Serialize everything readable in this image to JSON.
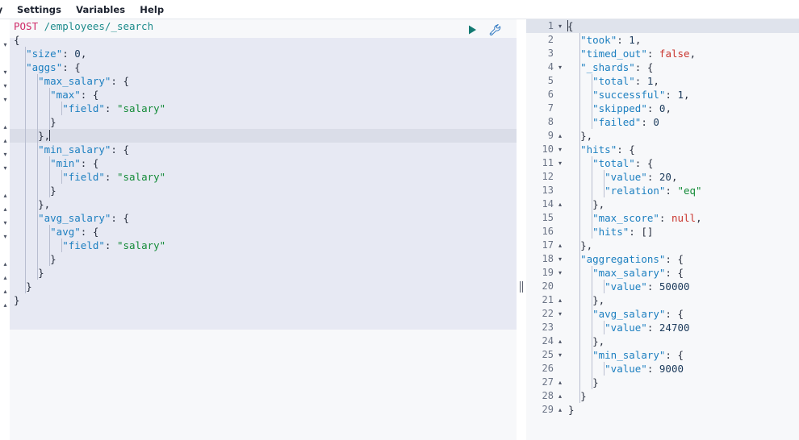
{
  "menubar": {
    "items": [
      {
        "label": "ry",
        "name": "menu-history",
        "clipped": true
      },
      {
        "label": "Settings",
        "name": "menu-settings",
        "clipped": false
      },
      {
        "label": "Variables",
        "name": "menu-variables",
        "clipped": false
      },
      {
        "label": "Help",
        "name": "menu-help",
        "clipped": false
      }
    ]
  },
  "toolbar": {
    "send_request_label": "send-request",
    "wrench_label": "tools-menu",
    "send_color": "#137a72",
    "wrench_color": "#3a7fc4"
  },
  "request": {
    "method": "POST",
    "path": "/employees/_search",
    "active_line_index": 7,
    "lines": [
      {
        "fold": "open",
        "indent": 0,
        "text": "{"
      },
      {
        "fold": "none",
        "indent": 1,
        "text": "  \"size\": 0,"
      },
      {
        "fold": "open",
        "indent": 1,
        "text": "  \"aggs\": {"
      },
      {
        "fold": "open",
        "indent": 2,
        "text": "    \"max_salary\": {"
      },
      {
        "fold": "open",
        "indent": 3,
        "text": "      \"max\": {"
      },
      {
        "fold": "none",
        "indent": 4,
        "text": "        \"field\": \"salary\""
      },
      {
        "fold": "close",
        "indent": 3,
        "text": "      }"
      },
      {
        "fold": "close",
        "indent": 2,
        "text": "    },"
      },
      {
        "fold": "open",
        "indent": 2,
        "text": "    \"min_salary\": {"
      },
      {
        "fold": "open",
        "indent": 3,
        "text": "      \"min\": {"
      },
      {
        "fold": "none",
        "indent": 4,
        "text": "        \"field\": \"salary\""
      },
      {
        "fold": "close",
        "indent": 3,
        "text": "      }"
      },
      {
        "fold": "close",
        "indent": 2,
        "text": "    },"
      },
      {
        "fold": "open",
        "indent": 2,
        "text": "    \"avg_salary\": {"
      },
      {
        "fold": "open",
        "indent": 3,
        "text": "      \"avg\": {"
      },
      {
        "fold": "none",
        "indent": 4,
        "text": "        \"field\": \"salary\""
      },
      {
        "fold": "close",
        "indent": 3,
        "text": "      }"
      },
      {
        "fold": "close",
        "indent": 2,
        "text": "    }"
      },
      {
        "fold": "close",
        "indent": 1,
        "text": "  }"
      },
      {
        "fold": "close",
        "indent": 0,
        "text": "}"
      }
    ]
  },
  "response": {
    "active_line_number": 1,
    "lines": [
      {
        "n": 1,
        "fold": "open",
        "indent": 0,
        "text": "{"
      },
      {
        "n": 2,
        "fold": "none",
        "indent": 1,
        "text": "  \"took\": 1,"
      },
      {
        "n": 3,
        "fold": "none",
        "indent": 1,
        "text": "  \"timed_out\": false,"
      },
      {
        "n": 4,
        "fold": "open",
        "indent": 1,
        "text": "  \"_shards\": {"
      },
      {
        "n": 5,
        "fold": "none",
        "indent": 2,
        "text": "    \"total\": 1,"
      },
      {
        "n": 6,
        "fold": "none",
        "indent": 2,
        "text": "    \"successful\": 1,"
      },
      {
        "n": 7,
        "fold": "none",
        "indent": 2,
        "text": "    \"skipped\": 0,"
      },
      {
        "n": 8,
        "fold": "none",
        "indent": 2,
        "text": "    \"failed\": 0"
      },
      {
        "n": 9,
        "fold": "close",
        "indent": 1,
        "text": "  },"
      },
      {
        "n": 10,
        "fold": "open",
        "indent": 1,
        "text": "  \"hits\": {"
      },
      {
        "n": 11,
        "fold": "open",
        "indent": 2,
        "text": "    \"total\": {"
      },
      {
        "n": 12,
        "fold": "none",
        "indent": 3,
        "text": "      \"value\": 20,"
      },
      {
        "n": 13,
        "fold": "none",
        "indent": 3,
        "text": "      \"relation\": \"eq\""
      },
      {
        "n": 14,
        "fold": "close",
        "indent": 2,
        "text": "    },"
      },
      {
        "n": 15,
        "fold": "none",
        "indent": 2,
        "text": "    \"max_score\": null,"
      },
      {
        "n": 16,
        "fold": "none",
        "indent": 2,
        "text": "    \"hits\": []"
      },
      {
        "n": 17,
        "fold": "close",
        "indent": 1,
        "text": "  },"
      },
      {
        "n": 18,
        "fold": "open",
        "indent": 1,
        "text": "  \"aggregations\": {"
      },
      {
        "n": 19,
        "fold": "open",
        "indent": 2,
        "text": "    \"max_salary\": {"
      },
      {
        "n": 20,
        "fold": "none",
        "indent": 3,
        "text": "      \"value\": 50000"
      },
      {
        "n": 21,
        "fold": "close",
        "indent": 2,
        "text": "    },"
      },
      {
        "n": 22,
        "fold": "open",
        "indent": 2,
        "text": "    \"avg_salary\": {"
      },
      {
        "n": 23,
        "fold": "none",
        "indent": 3,
        "text": "      \"value\": 24700"
      },
      {
        "n": 24,
        "fold": "close",
        "indent": 2,
        "text": "    },"
      },
      {
        "n": 25,
        "fold": "open",
        "indent": 2,
        "text": "    \"min_salary\": {"
      },
      {
        "n": 26,
        "fold": "none",
        "indent": 3,
        "text": "      \"value\": 9000"
      },
      {
        "n": 27,
        "fold": "close",
        "indent": 2,
        "text": "    }"
      },
      {
        "n": 28,
        "fold": "close",
        "indent": 1,
        "text": "  }"
      },
      {
        "n": 29,
        "fold": "close",
        "indent": 0,
        "text": "}"
      }
    ]
  },
  "splitter": {
    "label": "panel-resizer"
  }
}
